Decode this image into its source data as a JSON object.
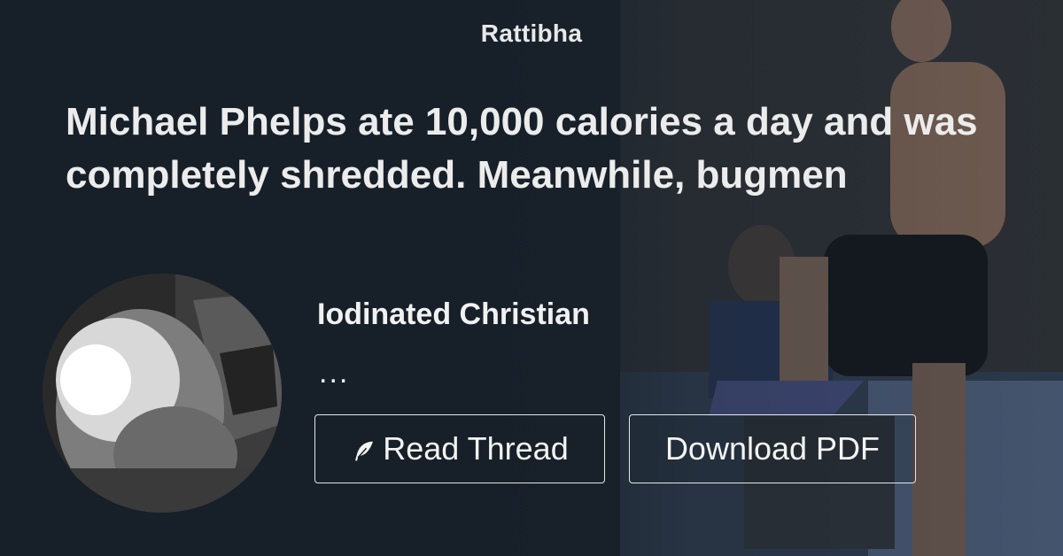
{
  "brand": "Rattibha",
  "thread_title": "Michael Phelps ate 10,000 calories a day and was completely shredded. Meanwhile, bugmen",
  "author": {
    "name": "Iodinated Christian",
    "handle_placeholder": "..."
  },
  "actions": {
    "read_thread": "Read Thread",
    "download_pdf": "Download PDF"
  },
  "icons": {
    "read_thread": "feather-icon"
  },
  "colors": {
    "background": "#172029",
    "text": "#ececec",
    "button_border": "#e6e6e6"
  }
}
